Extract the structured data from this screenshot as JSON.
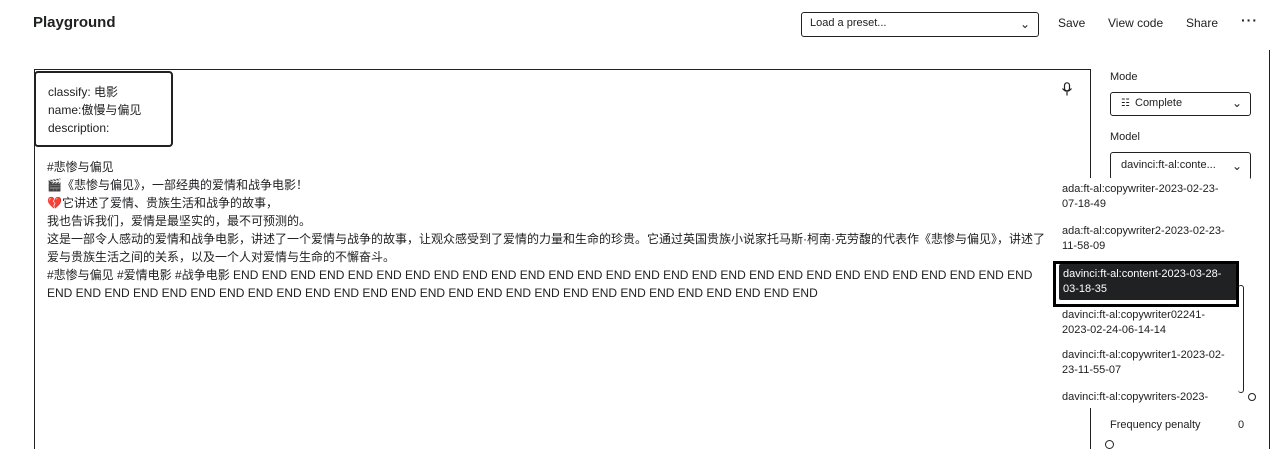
{
  "header": {
    "title": "Playground",
    "preset_placeholder": "Load a preset...",
    "save_label": "Save",
    "view_code_label": "View code",
    "share_label": "Share",
    "more_label": "···"
  },
  "prompt": {
    "lines": [
      "classify: 电影",
      "name:傲慢与偏见",
      "description:"
    ]
  },
  "completion": {
    "lines": [
      "#悲惨与偏见",
      "🎬《悲惨与偏见》，一部经典的爱情和战争电影！",
      "💔它讲述了爱情、贵族生活和战争的故事，",
      "我也告诉我们，爱情是最坚实的，最不可预测的。",
      "这是一部令人感动的爱情和战争电影，讲述了一个爱情与战争的故事，让观众感受到了爱情的力量和生命的珍贵。它通过英国贵族小说家托马斯·柯南·克劳馥的代表作《悲惨与偏见》，讲述了爱与贵族生活之间的关系，以及一个人对爱情与生命的不懈奋斗。",
      "#悲惨与偏见 #爱情电影 #战争电影 END END END END END END END END END END END END END END END END END END END END END END END END END END END END END END END END END END END END END END END END END END END END END END END END END END END END END END END"
    ]
  },
  "sidebar": {
    "mode_label": "Mode",
    "mode_value": "Complete",
    "model_label": "Model",
    "model_value": "davinci:ft-al:conte...",
    "model_options": [
      "ada:ft-al:copywriter-2023-02-23-07-18-49",
      "ada:ft-al:copywriter2-2023-02-23-11-58-09",
      "davinci:ft-al:content-2023-03-28-03-18-35",
      "davinci:ft-al:copywriter02241-2023-02-24-06-14-14",
      "davinci:ft-al:copywriter1-2023-02-23-11-55-07",
      "davinci:ft-al:copywriters-2023-"
    ],
    "selected_index": 2,
    "frequency_label": "Frequency penalty",
    "frequency_value": "0"
  },
  "colors": {
    "text": "#202123",
    "background": "#ffffff",
    "selected_bg": "#202123"
  },
  "icons": {
    "mic": "microphone-icon",
    "chevron": "chevron-down-icon",
    "mode": "list-icon"
  }
}
